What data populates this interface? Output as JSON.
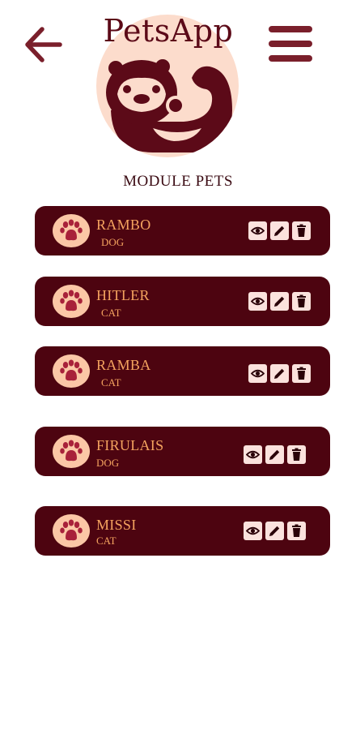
{
  "header": {
    "app_title": "PetsApp",
    "back_icon": "arrow-left-icon",
    "menu_icon": "hamburger-menu-icon",
    "logo_icon": "otter-logo-icon"
  },
  "section": {
    "title": "MODULE PETS"
  },
  "colors": {
    "brand_dark": "#4d0410",
    "accent_text": "#f4a35f",
    "logo_bg": "#fcdccc",
    "avatar_bg": "#fbc7a6",
    "action_bg": "#fbe2dd",
    "nav_color": "#7a1f2b"
  },
  "pets": [
    {
      "name": "RAMBO",
      "type": "DOG"
    },
    {
      "name": "HITLER",
      "type": "CAT"
    },
    {
      "name": "RAMBA",
      "type": "CAT"
    },
    {
      "name": "FIRULAIS",
      "type": "DOG"
    },
    {
      "name": "MISSI",
      "type": "CAT"
    }
  ],
  "pet_actions": [
    "view-eye-icon",
    "edit-pencil-icon",
    "delete-trash-icon"
  ]
}
